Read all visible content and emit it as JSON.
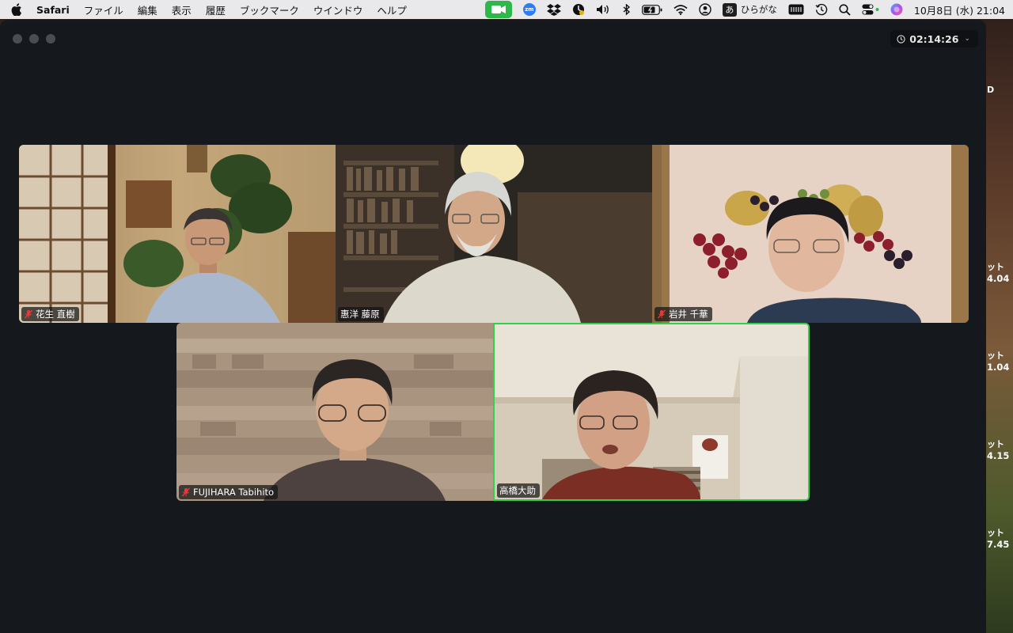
{
  "menubar": {
    "app_name": "Safari",
    "menus": [
      "ファイル",
      "編集",
      "表示",
      "履歴",
      "ブックマーク",
      "ウインドウ",
      "ヘルプ"
    ],
    "status_icons": [
      "zoom-video-icon",
      "zoom-app-icon",
      "dropbox-icon",
      "backup-icon",
      "volume-icon",
      "bluetooth-icon",
      "battery-icon",
      "wifi-icon",
      "user-icon"
    ],
    "ime_badge": "あ",
    "ime_label": "ひらがな",
    "clock": "10月8日 (水)  21:04",
    "accent_color": "#2db84a"
  },
  "meeting": {
    "timer": "02:14:26",
    "active_speaker_color": "#2fd14c",
    "participants": [
      {
        "name": "花生 直樹",
        "muted": true
      },
      {
        "name": "惠洋 藤原",
        "muted": false
      },
      {
        "name": "岩井 千華",
        "muted": true
      },
      {
        "name": "FUJIHARA Tabihito",
        "muted": true
      },
      {
        "name": "高橋大助",
        "muted": false,
        "active": true
      }
    ]
  },
  "desktop_widgets": {
    "top_letter": "D",
    "items": [
      {
        "label": "ット",
        "value": "4.04"
      },
      {
        "label": "ット",
        "value": "1.04"
      },
      {
        "label": "ット",
        "value": "4.15"
      },
      {
        "label": "ット",
        "value": "7.45"
      }
    ]
  }
}
